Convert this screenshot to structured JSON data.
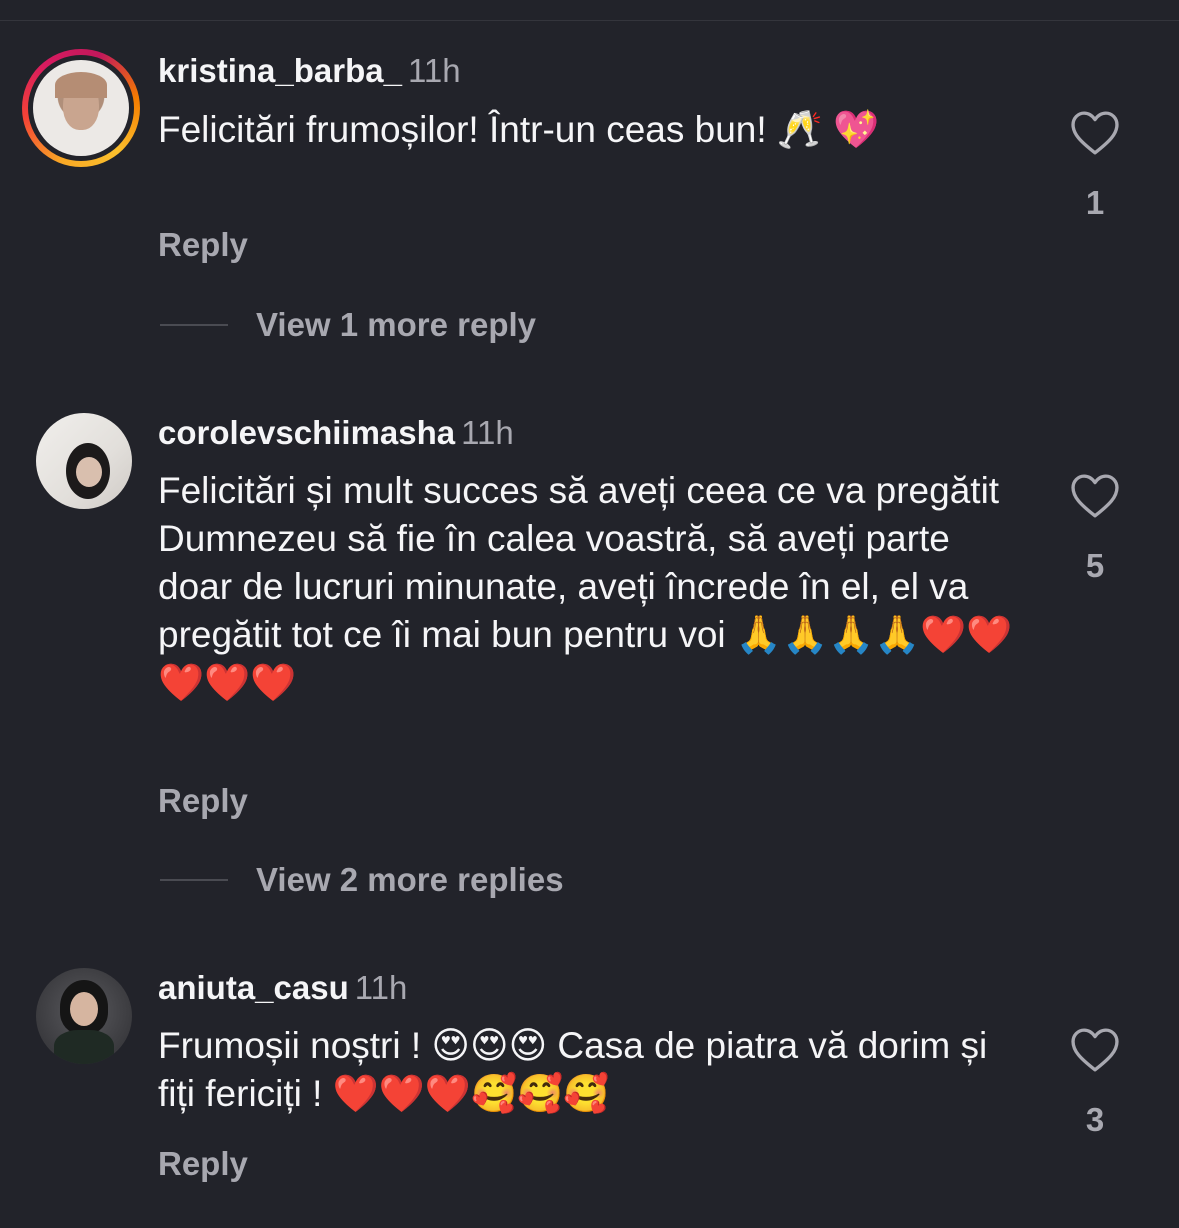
{
  "comments": [
    {
      "username": "kristina_barba_",
      "time": "11h",
      "text": "Felicitări frumoșilor! Într-un ceas bun! 🥂 💖",
      "reply_label": "Reply",
      "likes": "1",
      "view_more": "View 1 more reply",
      "has_story_ring": true
    },
    {
      "username": "corolevschiimasha",
      "time": "11h",
      "text": "Felicitări și mult succes să aveți ceea ce va pregătit Dumnezeu să fie în calea voastră, să aveți parte doar de lucruri minunate, aveți încrede în el, el va pregătit tot ce îi mai bun pentru voi 🙏🙏🙏🙏❤️❤️❤️❤️❤️",
      "reply_label": "Reply",
      "likes": "5",
      "view_more": "View 2 more replies",
      "has_story_ring": false
    },
    {
      "username": "aniuta_casu",
      "time": "11h",
      "text": "Frumoșii noștri ! 😍😍😍 Casa de piatra vă dorim și fiți fericiți ! ❤️❤️❤️🥰🥰🥰",
      "reply_label": "Reply",
      "likes": "3",
      "has_story_ring": false
    }
  ],
  "icons": {
    "like": "heart-outline-icon"
  },
  "colors": {
    "background": "#22232a",
    "text": "#f5f5f7",
    "secondary": "#a8a8b0"
  }
}
